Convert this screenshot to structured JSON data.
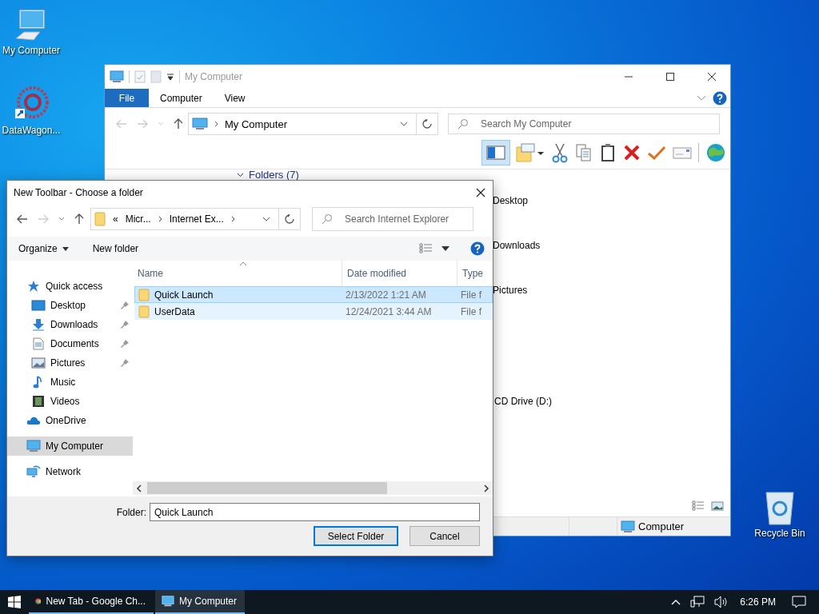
{
  "desktop_icons": [
    {
      "label": "My Computer",
      "kind": "computer"
    },
    {
      "label": "DataWagon...",
      "kind": "shortcut"
    },
    {
      "label": "Recycle Bin",
      "kind": "recycle"
    }
  ],
  "explorer": {
    "title": "My Computer",
    "ribbon_tabs": [
      {
        "label": "File",
        "kind": "menu"
      },
      {
        "label": "Computer",
        "kind": "tab"
      },
      {
        "label": "View",
        "kind": "tab"
      }
    ],
    "address": "My Computer",
    "search": {
      "placeholder": "Search My Computer"
    },
    "preview_pane_on": true,
    "group_header": "Folders (7)",
    "folders": [
      "Desktop",
      "Downloads",
      "Pictures"
    ],
    "drives": [
      "CD Drive (D:)"
    ],
    "status": "Computer"
  },
  "dialog": {
    "title": "New Toolbar - Choose a folder",
    "overflow": "«",
    "path": [
      "Micr...",
      "Internet Ex..."
    ],
    "search": {
      "placeholder": "Search Internet Explorer"
    },
    "commands": [
      {
        "label": "Organize",
        "dropdown": true
      },
      {
        "label": "New folder",
        "dropdown": false
      }
    ],
    "nav": [
      {
        "label": "Quick access",
        "kind": "star",
        "selected": false,
        "children": [
          {
            "label": "Desktop",
            "kind": "desktop",
            "pinned": true,
            "selected": false
          },
          {
            "label": "Downloads",
            "kind": "download",
            "pinned": true,
            "selected": false
          },
          {
            "label": "Documents",
            "kind": "document",
            "pinned": true,
            "selected": false
          },
          {
            "label": "Pictures",
            "kind": "picture",
            "pinned": true,
            "selected": false
          },
          {
            "label": "Music",
            "kind": "music",
            "pinned": false,
            "selected": false
          },
          {
            "label": "Videos",
            "kind": "video",
            "pinned": false,
            "selected": false
          }
        ]
      },
      {
        "label": "OneDrive",
        "kind": "cloud",
        "selected": false
      },
      {
        "label": "My Computer",
        "kind": "computer",
        "selected": true
      },
      {
        "label": "Network",
        "kind": "network",
        "selected": false
      }
    ],
    "columns": [
      "Name",
      "Date modified",
      "Type"
    ],
    "rows": [
      {
        "name": "Quick Launch",
        "date": "2/13/2022 1:21 AM",
        "type": "File f",
        "selected": true,
        "hovered": false
      },
      {
        "name": "UserData",
        "date": "12/24/2021 3:44 AM",
        "type": "File f",
        "selected": false,
        "hovered": true
      }
    ],
    "folder_label": "Folder:",
    "folder_value": "Quick Launch",
    "buttons": [
      {
        "label": "Select Folder",
        "kind": "default"
      },
      {
        "label": "Cancel",
        "kind": "normal"
      }
    ]
  },
  "taskbar": {
    "apps": [
      {
        "label": "New Tab - Google Ch...",
        "kind": "chrome",
        "selected": false
      },
      {
        "label": "My Computer",
        "kind": "computer",
        "selected": true
      }
    ],
    "clock": "6:26 PM"
  }
}
